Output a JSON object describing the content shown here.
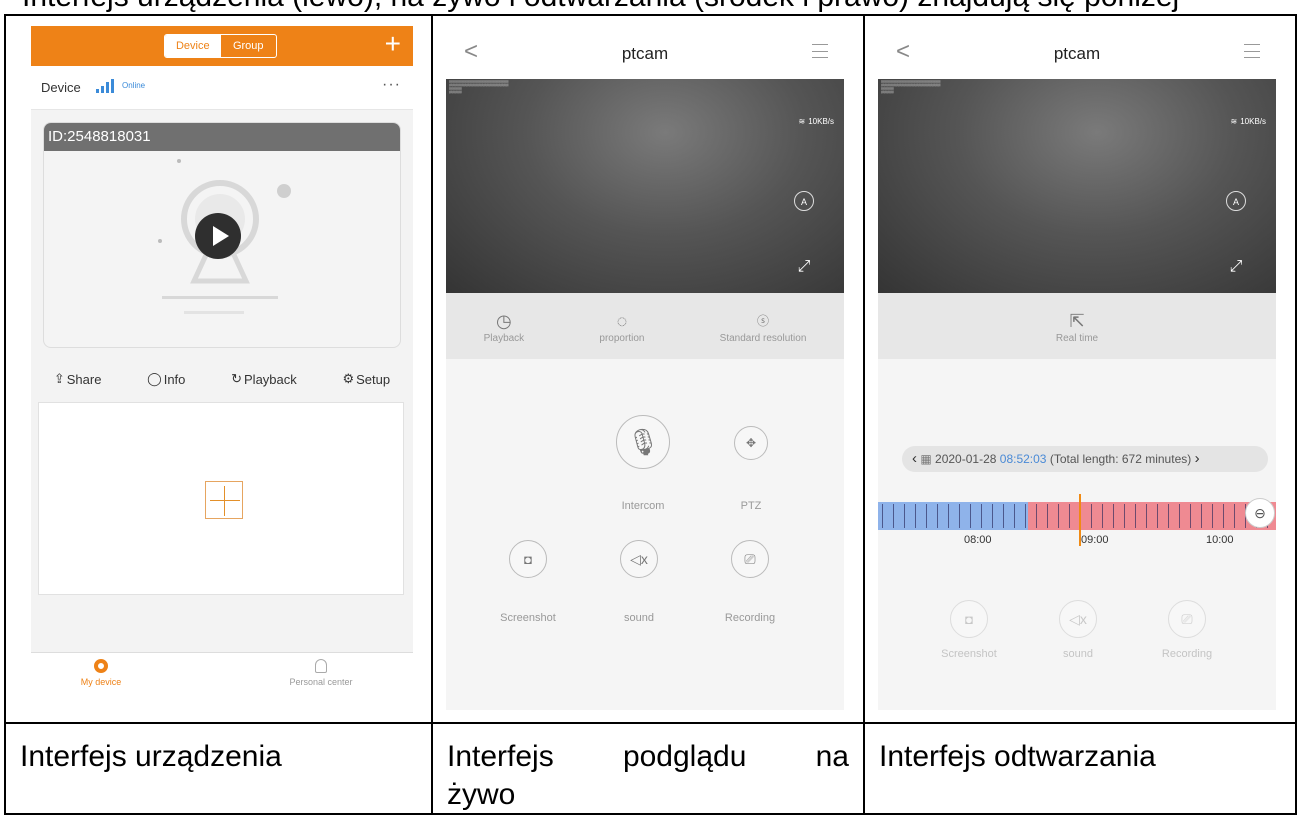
{
  "top_caption": "Interfejs urządzenia (lewo), na żywo i odtwarzania (środek i prawo) znajdują się poniżej",
  "captions": {
    "device": "Interfejs urządzenia",
    "live_w1": "Interfejs",
    "live_w2": "podglądu",
    "live_w3": "na",
    "live_w4": "żywo",
    "playback": "Interfejs odtwarzania"
  },
  "colors": {
    "accent": "#ee8217",
    "link": "#3b8bd9",
    "timeline_blue": "#8fb3ea",
    "timeline_red": "#ef8a92",
    "needle": "#f08a14"
  },
  "device_screen": {
    "seg_device": "Device",
    "seg_group": "Group",
    "add_icon": "plus-icon",
    "device_label": "Device",
    "status": "Online",
    "more": "···",
    "camera_id": "ID:2548818031",
    "actions": [
      {
        "icon": "share-icon",
        "glyph": "⇪",
        "label": "Share"
      },
      {
        "icon": "info-icon",
        "glyph": "◯",
        "label": "Info"
      },
      {
        "icon": "playback-icon",
        "glyph": "↻",
        "label": "Playback"
      },
      {
        "icon": "gear-icon",
        "glyph": "⚙",
        "label": "Setup"
      }
    ],
    "tabs": [
      {
        "label": "My device",
        "icon": "camera-icon"
      },
      {
        "label": "Personal center",
        "icon": "person-icon"
      }
    ]
  },
  "live_screen": {
    "title": "ptcam",
    "wifi_speed": "10KB/s",
    "tools": [
      {
        "label": "Playback",
        "icon": "history-icon"
      },
      {
        "label": "proportion",
        "icon": "aspect-ratio-icon"
      },
      {
        "label": "Standard resolution",
        "icon": "sd-icon"
      }
    ],
    "intercom": "Intercom",
    "ptz": "PTZ",
    "screenshot": "Screenshot",
    "sound": "sound",
    "recording": "Recording"
  },
  "playback_screen": {
    "title": "ptcam",
    "wifi_speed": "10KB/s",
    "realtime": "Real time",
    "date": "2020-01-28",
    "time": "08:52:03",
    "total": "(Total length: 672 minutes)",
    "ticks": [
      "08:00",
      "09:00",
      "10:00"
    ],
    "screenshot": "Screenshot",
    "sound": "sound",
    "recording": "Recording"
  }
}
